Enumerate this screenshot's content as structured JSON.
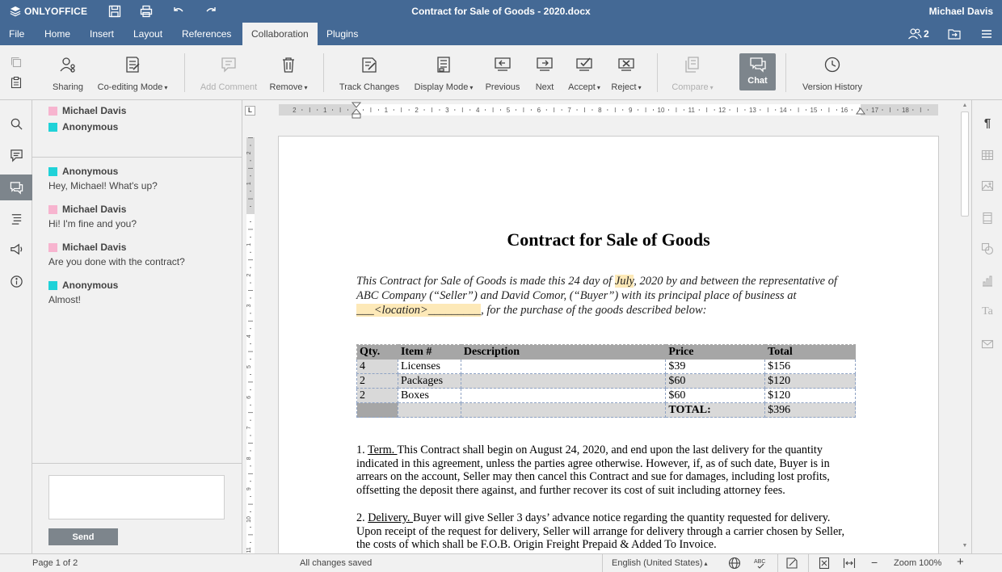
{
  "app": {
    "logo_text": "ONLYOFFICE",
    "doc_title": "Contract for Sale of Goods - 2020.docx",
    "user_name": "Michael Davis",
    "users_count": "2"
  },
  "menu": {
    "tabs": [
      "File",
      "Home",
      "Insert",
      "Layout",
      "References",
      "Collaboration",
      "Plugins"
    ],
    "active": "Collaboration"
  },
  "toolbar": {
    "sharing": "Sharing",
    "coediting": "Co-editing Mode",
    "add_comment": "Add Comment",
    "remove": "Remove",
    "track_changes": "Track Changes",
    "display_mode": "Display Mode",
    "previous": "Previous",
    "next": "Next",
    "accept": "Accept",
    "reject": "Reject",
    "compare": "Compare",
    "chat": "Chat",
    "version_history": "Version History"
  },
  "chat": {
    "participants": [
      {
        "name": "Michael Davis",
        "color": "#f7b4cf"
      },
      {
        "name": "Anonymous",
        "color": "#20d2d8"
      }
    ],
    "messages": [
      {
        "author": "Anonymous",
        "text": "Hey, Michael! What's up?",
        "color": "#20d2d8"
      },
      {
        "author": "Michael Davis",
        "text": "Hi! I'm fine and you?",
        "color": "#f7b4cf"
      },
      {
        "author": "Michael Davis",
        "text": "Are you done with the contract?",
        "color": "#f7b4cf"
      },
      {
        "author": "Anonymous",
        "text": "Almost!",
        "color": "#20d2d8"
      }
    ],
    "input_value": "",
    "send_label": "Send"
  },
  "ruler": {
    "h_ticks": [
      "2",
      "1",
      "1",
      "2",
      "3",
      "4",
      "5",
      "6",
      "7",
      "8",
      "9",
      "10",
      "11",
      "12",
      "13",
      "14",
      "15",
      "16",
      "17",
      "18"
    ],
    "v_ticks": [
      "2",
      "1",
      "1",
      "2",
      "3",
      "4",
      "5",
      "6",
      "7",
      "8",
      "9",
      "10",
      "11"
    ],
    "corner": "L"
  },
  "document": {
    "heading": "Contract for Sale of Goods",
    "intro": {
      "before": "This Contract for Sale of Goods is made this 24 day of ",
      "month": "July",
      "middle": ", 2020 by and between the representative of ABC Company (“Seller”) and David Comor, (“Buyer”) with its principal place of business at ",
      "location": "___<location>_________",
      "after": ", for the purchase of the goods described below:"
    },
    "table": {
      "headers": [
        "Qty.",
        "Item #",
        "Description",
        "Price",
        "Total"
      ],
      "rows": [
        [
          "4",
          "Licenses",
          "",
          "$39",
          "$156"
        ],
        [
          "2",
          "Packages",
          "",
          "$60",
          "$120"
        ],
        [
          "2",
          "Boxes",
          "",
          "$60",
          "$120"
        ]
      ],
      "total_label": "TOTAL:",
      "total_value": "$396"
    },
    "p1_num": "1. ",
    "p1_head": "Term. ",
    "p1_body": "This Contract shall begin on August 24, 2020, and end upon the last delivery for the quantity indicated in this agreement, unless the parties agree otherwise. However, if, as of such date, Buyer is in arrears on the account, Seller may then cancel this Contract and sue for damages, including lost profits, offsetting the deposit there against, and further recover its cost of suit including attorney fees.",
    "p2_num": "2. ",
    "p2_head": "Delivery. ",
    "p2_body": "Buyer will give Seller 3 days’ advance notice regarding the quantity requested for delivery. Upon receipt of the request for delivery, Seller will arrange for delivery through a carrier chosen by Seller, the costs of which shall be F.O.B. Origin Freight Prepaid & Added To Invoice."
  },
  "status": {
    "page": "Page 1 of 2",
    "saved": "All changes saved",
    "language": "English (United States)",
    "zoom": "Zoom 100%"
  }
}
